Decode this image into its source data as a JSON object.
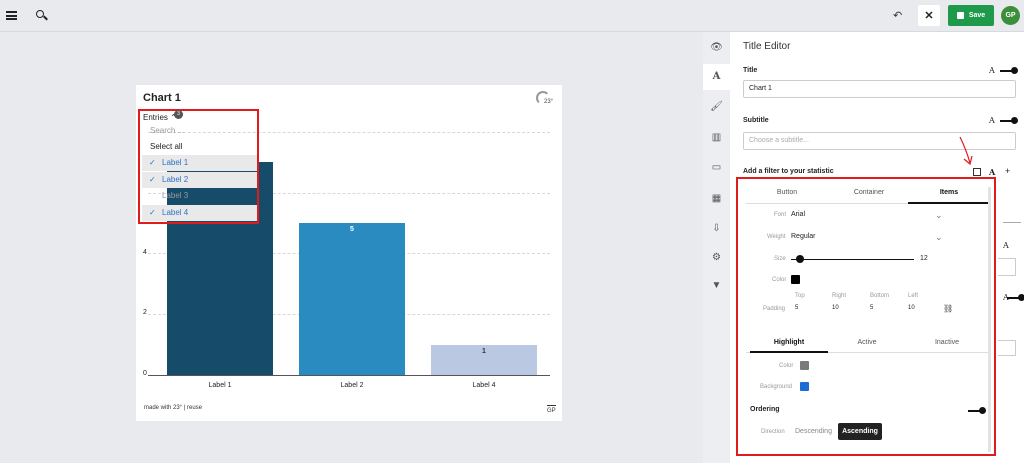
{
  "topbar": {
    "save_label": "Save",
    "avatar": "GP"
  },
  "chart": {
    "title": "Chart 1",
    "footer_left": "made with 23° | reuse",
    "footer_right": "GP",
    "logo_text": "23°"
  },
  "dropdown": {
    "label": "Entries",
    "badge": "3",
    "search_placeholder": "Search ...",
    "select_all": "Select all",
    "items": [
      {
        "label": "Label 1",
        "selected": true
      },
      {
        "label": "Label 2",
        "selected": true
      },
      {
        "label": "Label 3",
        "selected": false
      },
      {
        "label": "Label 4",
        "selected": true
      }
    ]
  },
  "chart_data": {
    "type": "bar",
    "categories": [
      "Label 1",
      "Label 2",
      "Label 4"
    ],
    "values": [
      7,
      5,
      1
    ],
    "colors": [
      "#164b69",
      "#2a8bc1",
      "#bac8e2"
    ],
    "yticks": [
      0,
      2,
      4
    ],
    "ylim": [
      0,
      8
    ],
    "data_labels": [
      "",
      "5",
      "1"
    ],
    "grid": true
  },
  "editor": {
    "header": "Title Editor",
    "title_label": "Title",
    "title_value": "Chart 1",
    "subtitle_label": "Subtitle",
    "subtitle_placeholder": "Choose a subtitle...",
    "filter_label": "Add a filter to your statistic",
    "font_icon": "A",
    "add_icon": "+",
    "tabs": [
      "Button",
      "Container",
      "Items"
    ],
    "font_label": "Font",
    "font_value": "Arial",
    "weight_label": "Weight",
    "weight_value": "Regular",
    "size_label": "Size",
    "size_value": "12",
    "size_fraction": 0.07,
    "color_label": "Color",
    "color_value": "#000000",
    "padding_label": "Padding",
    "pad_heads": [
      "Top",
      "Right",
      "Bottom",
      "Left"
    ],
    "pad_vals": [
      "5",
      "10",
      "5",
      "10"
    ],
    "state_tabs": [
      "Highlight",
      "Active",
      "Inactive"
    ],
    "hl_color_label": "Color",
    "hl_color": "#7a7a7a",
    "hl_bg_label": "Background",
    "hl_bg": "#1e6bd6",
    "ordering_label": "Ordering",
    "direction_label": "Direction",
    "dir_options": [
      "Descending",
      "Ascending"
    ]
  }
}
